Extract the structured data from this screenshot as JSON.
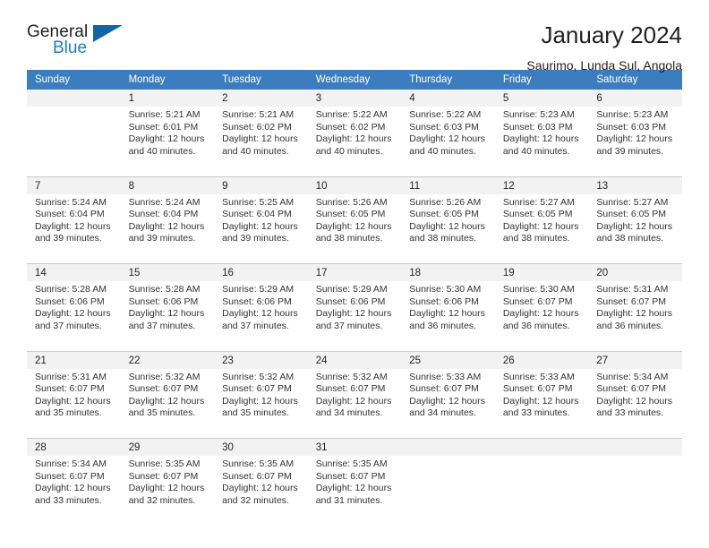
{
  "brand": {
    "name_part1": "General",
    "name_part2": "Blue",
    "triangle_icon": "blue-triangle-logo-mark"
  },
  "header": {
    "title": "January 2024",
    "subtitle": "Saurimo, Lunda Sul, Angola"
  },
  "colors": {
    "header_blue": "#3b7dbf",
    "logo_blue": "#1c7cc4",
    "daynum_row": "#f2f2f2",
    "text": "#231f20",
    "separator": "#c9c9c9"
  },
  "calendar": {
    "weekdays": [
      "Sunday",
      "Monday",
      "Tuesday",
      "Wednesday",
      "Thursday",
      "Friday",
      "Saturday"
    ],
    "weeks": [
      [
        {
          "day": "",
          "sunrise": "",
          "sunset": "",
          "daylight1": "",
          "daylight2": ""
        },
        {
          "day": "1",
          "sunrise": "Sunrise: 5:21 AM",
          "sunset": "Sunset: 6:01 PM",
          "daylight1": "Daylight: 12 hours",
          "daylight2": "and 40 minutes."
        },
        {
          "day": "2",
          "sunrise": "Sunrise: 5:21 AM",
          "sunset": "Sunset: 6:02 PM",
          "daylight1": "Daylight: 12 hours",
          "daylight2": "and 40 minutes."
        },
        {
          "day": "3",
          "sunrise": "Sunrise: 5:22 AM",
          "sunset": "Sunset: 6:02 PM",
          "daylight1": "Daylight: 12 hours",
          "daylight2": "and 40 minutes."
        },
        {
          "day": "4",
          "sunrise": "Sunrise: 5:22 AM",
          "sunset": "Sunset: 6:03 PM",
          "daylight1": "Daylight: 12 hours",
          "daylight2": "and 40 minutes."
        },
        {
          "day": "5",
          "sunrise": "Sunrise: 5:23 AM",
          "sunset": "Sunset: 6:03 PM",
          "daylight1": "Daylight: 12 hours",
          "daylight2": "and 40 minutes."
        },
        {
          "day": "6",
          "sunrise": "Sunrise: 5:23 AM",
          "sunset": "Sunset: 6:03 PM",
          "daylight1": "Daylight: 12 hours",
          "daylight2": "and 39 minutes."
        }
      ],
      [
        {
          "day": "7",
          "sunrise": "Sunrise: 5:24 AM",
          "sunset": "Sunset: 6:04 PM",
          "daylight1": "Daylight: 12 hours",
          "daylight2": "and 39 minutes."
        },
        {
          "day": "8",
          "sunrise": "Sunrise: 5:24 AM",
          "sunset": "Sunset: 6:04 PM",
          "daylight1": "Daylight: 12 hours",
          "daylight2": "and 39 minutes."
        },
        {
          "day": "9",
          "sunrise": "Sunrise: 5:25 AM",
          "sunset": "Sunset: 6:04 PM",
          "daylight1": "Daylight: 12 hours",
          "daylight2": "and 39 minutes."
        },
        {
          "day": "10",
          "sunrise": "Sunrise: 5:26 AM",
          "sunset": "Sunset: 6:05 PM",
          "daylight1": "Daylight: 12 hours",
          "daylight2": "and 38 minutes."
        },
        {
          "day": "11",
          "sunrise": "Sunrise: 5:26 AM",
          "sunset": "Sunset: 6:05 PM",
          "daylight1": "Daylight: 12 hours",
          "daylight2": "and 38 minutes."
        },
        {
          "day": "12",
          "sunrise": "Sunrise: 5:27 AM",
          "sunset": "Sunset: 6:05 PM",
          "daylight1": "Daylight: 12 hours",
          "daylight2": "and 38 minutes."
        },
        {
          "day": "13",
          "sunrise": "Sunrise: 5:27 AM",
          "sunset": "Sunset: 6:05 PM",
          "daylight1": "Daylight: 12 hours",
          "daylight2": "and 38 minutes."
        }
      ],
      [
        {
          "day": "14",
          "sunrise": "Sunrise: 5:28 AM",
          "sunset": "Sunset: 6:06 PM",
          "daylight1": "Daylight: 12 hours",
          "daylight2": "and 37 minutes."
        },
        {
          "day": "15",
          "sunrise": "Sunrise: 5:28 AM",
          "sunset": "Sunset: 6:06 PM",
          "daylight1": "Daylight: 12 hours",
          "daylight2": "and 37 minutes."
        },
        {
          "day": "16",
          "sunrise": "Sunrise: 5:29 AM",
          "sunset": "Sunset: 6:06 PM",
          "daylight1": "Daylight: 12 hours",
          "daylight2": "and 37 minutes."
        },
        {
          "day": "17",
          "sunrise": "Sunrise: 5:29 AM",
          "sunset": "Sunset: 6:06 PM",
          "daylight1": "Daylight: 12 hours",
          "daylight2": "and 37 minutes."
        },
        {
          "day": "18",
          "sunrise": "Sunrise: 5:30 AM",
          "sunset": "Sunset: 6:06 PM",
          "daylight1": "Daylight: 12 hours",
          "daylight2": "and 36 minutes."
        },
        {
          "day": "19",
          "sunrise": "Sunrise: 5:30 AM",
          "sunset": "Sunset: 6:07 PM",
          "daylight1": "Daylight: 12 hours",
          "daylight2": "and 36 minutes."
        },
        {
          "day": "20",
          "sunrise": "Sunrise: 5:31 AM",
          "sunset": "Sunset: 6:07 PM",
          "daylight1": "Daylight: 12 hours",
          "daylight2": "and 36 minutes."
        }
      ],
      [
        {
          "day": "21",
          "sunrise": "Sunrise: 5:31 AM",
          "sunset": "Sunset: 6:07 PM",
          "daylight1": "Daylight: 12 hours",
          "daylight2": "and 35 minutes."
        },
        {
          "day": "22",
          "sunrise": "Sunrise: 5:32 AM",
          "sunset": "Sunset: 6:07 PM",
          "daylight1": "Daylight: 12 hours",
          "daylight2": "and 35 minutes."
        },
        {
          "day": "23",
          "sunrise": "Sunrise: 5:32 AM",
          "sunset": "Sunset: 6:07 PM",
          "daylight1": "Daylight: 12 hours",
          "daylight2": "and 35 minutes."
        },
        {
          "day": "24",
          "sunrise": "Sunrise: 5:32 AM",
          "sunset": "Sunset: 6:07 PM",
          "daylight1": "Daylight: 12 hours",
          "daylight2": "and 34 minutes."
        },
        {
          "day": "25",
          "sunrise": "Sunrise: 5:33 AM",
          "sunset": "Sunset: 6:07 PM",
          "daylight1": "Daylight: 12 hours",
          "daylight2": "and 34 minutes."
        },
        {
          "day": "26",
          "sunrise": "Sunrise: 5:33 AM",
          "sunset": "Sunset: 6:07 PM",
          "daylight1": "Daylight: 12 hours",
          "daylight2": "and 33 minutes."
        },
        {
          "day": "27",
          "sunrise": "Sunrise: 5:34 AM",
          "sunset": "Sunset: 6:07 PM",
          "daylight1": "Daylight: 12 hours",
          "daylight2": "and 33 minutes."
        }
      ],
      [
        {
          "day": "28",
          "sunrise": "Sunrise: 5:34 AM",
          "sunset": "Sunset: 6:07 PM",
          "daylight1": "Daylight: 12 hours",
          "daylight2": "and 33 minutes."
        },
        {
          "day": "29",
          "sunrise": "Sunrise: 5:35 AM",
          "sunset": "Sunset: 6:07 PM",
          "daylight1": "Daylight: 12 hours",
          "daylight2": "and 32 minutes."
        },
        {
          "day": "30",
          "sunrise": "Sunrise: 5:35 AM",
          "sunset": "Sunset: 6:07 PM",
          "daylight1": "Daylight: 12 hours",
          "daylight2": "and 32 minutes."
        },
        {
          "day": "31",
          "sunrise": "Sunrise: 5:35 AM",
          "sunset": "Sunset: 6:07 PM",
          "daylight1": "Daylight: 12 hours",
          "daylight2": "and 31 minutes."
        },
        {
          "day": "",
          "sunrise": "",
          "sunset": "",
          "daylight1": "",
          "daylight2": ""
        },
        {
          "day": "",
          "sunrise": "",
          "sunset": "",
          "daylight1": "",
          "daylight2": ""
        },
        {
          "day": "",
          "sunrise": "",
          "sunset": "",
          "daylight1": "",
          "daylight2": ""
        }
      ]
    ]
  }
}
